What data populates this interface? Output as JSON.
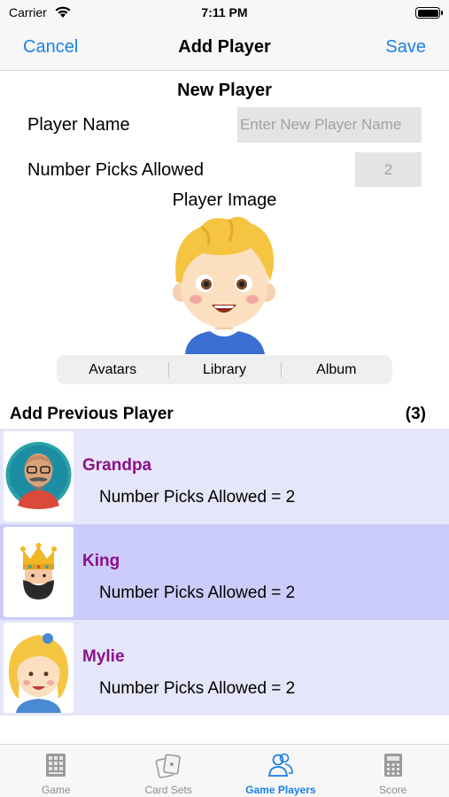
{
  "status_bar": {
    "carrier": "Carrier",
    "time": "7:11 PM"
  },
  "nav": {
    "cancel": "Cancel",
    "title": "Add Player",
    "save": "Save"
  },
  "form": {
    "section_title": "New Player",
    "player_name_label": "Player Name",
    "player_name_placeholder": "Enter New Player Name",
    "picks_label": "Number Picks Allowed",
    "picks_value": "2",
    "player_image_label": "Player Image",
    "image_sources": [
      "Avatars",
      "Library",
      "Album"
    ]
  },
  "previous": {
    "header": "Add Previous Player",
    "count": "(3)",
    "players": [
      {
        "name": "Grandpa",
        "picks": "Number Picks Allowed = 2",
        "bg": "#e6e6fa",
        "avatar": "grandpa-avatar-icon"
      },
      {
        "name": "King",
        "picks": "Number Picks Allowed = 2",
        "bg": "#ccccfa",
        "avatar": "king-avatar-icon"
      },
      {
        "name": "Mylie",
        "picks": "Number Picks Allowed = 2",
        "bg": "#e6e6fa",
        "avatar": "girl-avatar-icon"
      }
    ]
  },
  "tabs": [
    {
      "label": "Game",
      "icon": "calculator-grid-icon",
      "active": false
    },
    {
      "label": "Card Sets",
      "icon": "cards-icon",
      "active": false
    },
    {
      "label": "Game Players",
      "icon": "people-icon",
      "active": true
    },
    {
      "label": "Score",
      "icon": "calculator-icon",
      "active": false
    }
  ],
  "colors": {
    "accent": "#1a80e6",
    "player_name": "#8b118b",
    "row_light": "#e6e6fa",
    "row_selected": "#ccccfa"
  }
}
